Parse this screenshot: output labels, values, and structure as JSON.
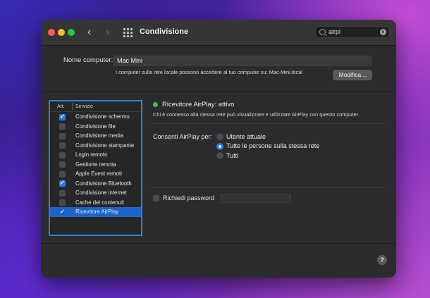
{
  "window": {
    "title": "Condivisione",
    "nav_back": "‹",
    "nav_forward": "›"
  },
  "search": {
    "value": "airpl",
    "clear_glyph": "×"
  },
  "computer_name": {
    "label": "Nome computer:",
    "value": "Mac Mini",
    "description": "I computer sulla rete locale possono accedere al tuo computer su: Mac-Mini.local",
    "edit_button": "Modifica..."
  },
  "services": {
    "header_on": "Att.",
    "header_service": "Servizio",
    "items": [
      {
        "label": "Condivisione schermo",
        "checked": true,
        "selected": false
      },
      {
        "label": "Condivisione file",
        "checked": false,
        "selected": false
      },
      {
        "label": "Condivisione media",
        "checked": false,
        "selected": false
      },
      {
        "label": "Condivisione stampante",
        "checked": false,
        "selected": false
      },
      {
        "label": "Login remoto",
        "checked": false,
        "selected": false
      },
      {
        "label": "Gestione remota",
        "checked": false,
        "selected": false
      },
      {
        "label": "Apple Event remoti",
        "checked": false,
        "selected": false
      },
      {
        "label": "Condivisione Bluetooth",
        "checked": true,
        "selected": false
      },
      {
        "label": "Condivisione internet",
        "checked": false,
        "selected": false
      },
      {
        "label": "Cache dei contenuti",
        "checked": false,
        "selected": false
      },
      {
        "label": "Ricevitore AirPlay",
        "checked": true,
        "selected": true
      }
    ]
  },
  "detail": {
    "status": "Ricevitore AirPlay: attivo",
    "status_color": "#2fc851",
    "description": "Chi è connesso alla stessa rete può visualizzare e utilizzare AirPlay con questo computer.",
    "allow_label": "Consenti AirPlay per:",
    "options": [
      {
        "label": "Utente attuale",
        "selected": false
      },
      {
        "label": "Tutte le persone sulla stessa rete",
        "selected": true
      },
      {
        "label": "Tutti",
        "selected": false
      }
    ],
    "password_label": "Richiedi password",
    "password_value": ""
  },
  "help": "?",
  "colors": {
    "accent": "#2a7be4",
    "selection": "#1c64c9",
    "window_bg": "#2b2b2d"
  }
}
